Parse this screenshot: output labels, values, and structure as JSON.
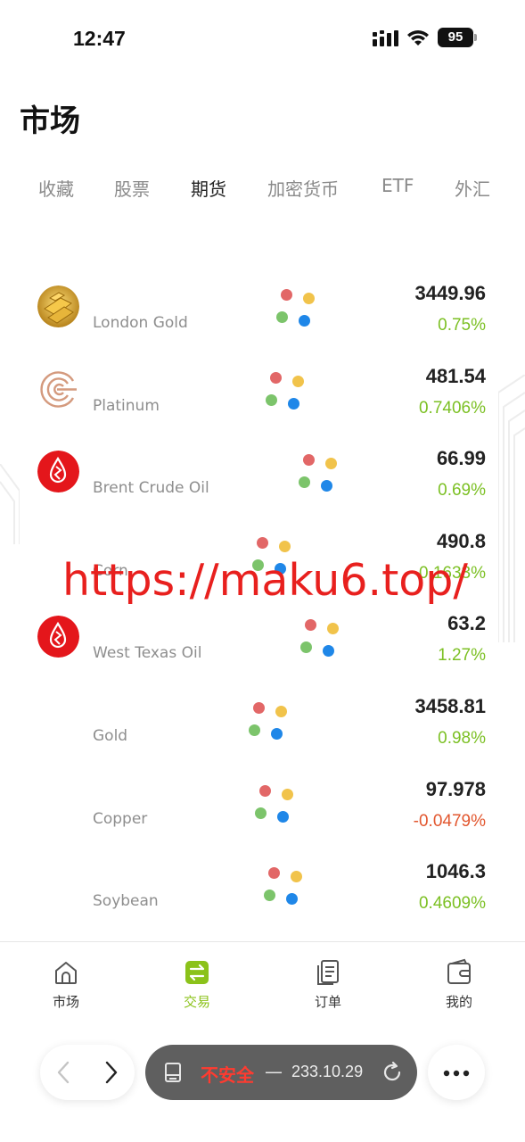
{
  "status_bar": {
    "time": "12:47",
    "battery": "95",
    "icons": [
      "signal-icon",
      "wifi-icon",
      "battery-icon"
    ]
  },
  "page": {
    "title": "市场"
  },
  "tabs": [
    {
      "label": "收藏",
      "active": false
    },
    {
      "label": "股票",
      "active": false
    },
    {
      "label": "期货",
      "active": true
    },
    {
      "label": "加密货币",
      "active": false
    },
    {
      "label": "ETF",
      "active": false
    },
    {
      "label": "外汇",
      "active": false
    }
  ],
  "markets": [
    {
      "name": "London Gold",
      "price": "3449.96",
      "change": "0.75%",
      "direction": "up",
      "icon": "gold-bars-icon"
    },
    {
      "name": "Platinum",
      "price": "481.54",
      "change": "0.7406%",
      "direction": "up",
      "icon": "platinum-logo-icon"
    },
    {
      "name": "Brent Crude Oil",
      "price": "66.99",
      "change": "0.69%",
      "direction": "up",
      "icon": "oil-drop-icon"
    },
    {
      "name": "Corn",
      "price": "490.8",
      "change": "0.1633%",
      "direction": "up",
      "icon": ""
    },
    {
      "name": "West Texas Oil",
      "price": "63.2",
      "change": "1.27%",
      "direction": "up",
      "icon": "oil-drop-icon"
    },
    {
      "name": "Gold",
      "price": "3458.81",
      "change": "0.98%",
      "direction": "up",
      "icon": ""
    },
    {
      "name": "Copper",
      "price": "97.978",
      "change": "-0.0479%",
      "direction": "down",
      "icon": ""
    },
    {
      "name": "Soybean",
      "price": "1046.3",
      "change": "0.4609%",
      "direction": "up",
      "icon": ""
    }
  ],
  "overlay": {
    "url": "https://maku6.top/"
  },
  "bottom_nav": [
    {
      "label": "市场",
      "icon": "home-icon",
      "active": false
    },
    {
      "label": "交易",
      "icon": "exchange-icon",
      "active": true
    },
    {
      "label": "订单",
      "icon": "orders-icon",
      "active": false
    },
    {
      "label": "我的",
      "icon": "wallet-icon",
      "active": false
    }
  ],
  "browser": {
    "insecure_label": "不安全",
    "dash": "—",
    "address": "233.10.29",
    "icons": [
      "back-arrow-icon",
      "forward-arrow-icon",
      "page-icon",
      "reload-icon",
      "more-icon"
    ]
  },
  "colors": {
    "positive": "#7cc024",
    "negative": "#e2572f",
    "accent": "#8bc21a",
    "insecure": "#ff3b30",
    "overlay": "#e8201e"
  }
}
